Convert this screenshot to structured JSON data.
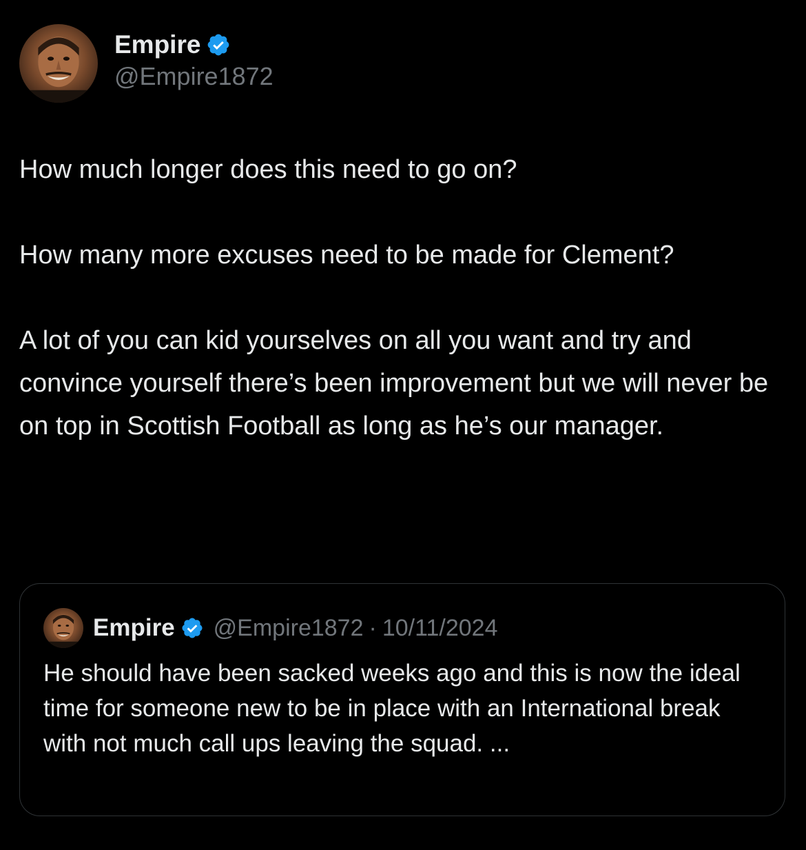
{
  "colors": {
    "background": "#000000",
    "text_primary": "#e7e9ea",
    "text_secondary": "#71767b",
    "verified_blue": "#1d9bf0",
    "border": "#2f3336"
  },
  "author": {
    "display_name": "Empire",
    "handle": "@Empire1872",
    "verified": true,
    "avatar_icon": "profile-photo-icon"
  },
  "tweet": {
    "paragraphs": [
      "How much longer does this need to go on?",
      "How many more excuses need to be made for Clement?",
      "A lot of you can kid yourselves on all you want and try and convince yourself there’s been improvement but we will never be on top in Scottish Football as long as he’s our manager."
    ]
  },
  "quoted_tweet": {
    "display_name": "Empire",
    "handle": "@Empire1872",
    "separator": "·",
    "date": "10/11/2024",
    "verified": true,
    "text": "He should have been sacked weeks ago and this is now the ideal time for someone new to be in place with an International break with not much call ups leaving the squad. ..."
  }
}
